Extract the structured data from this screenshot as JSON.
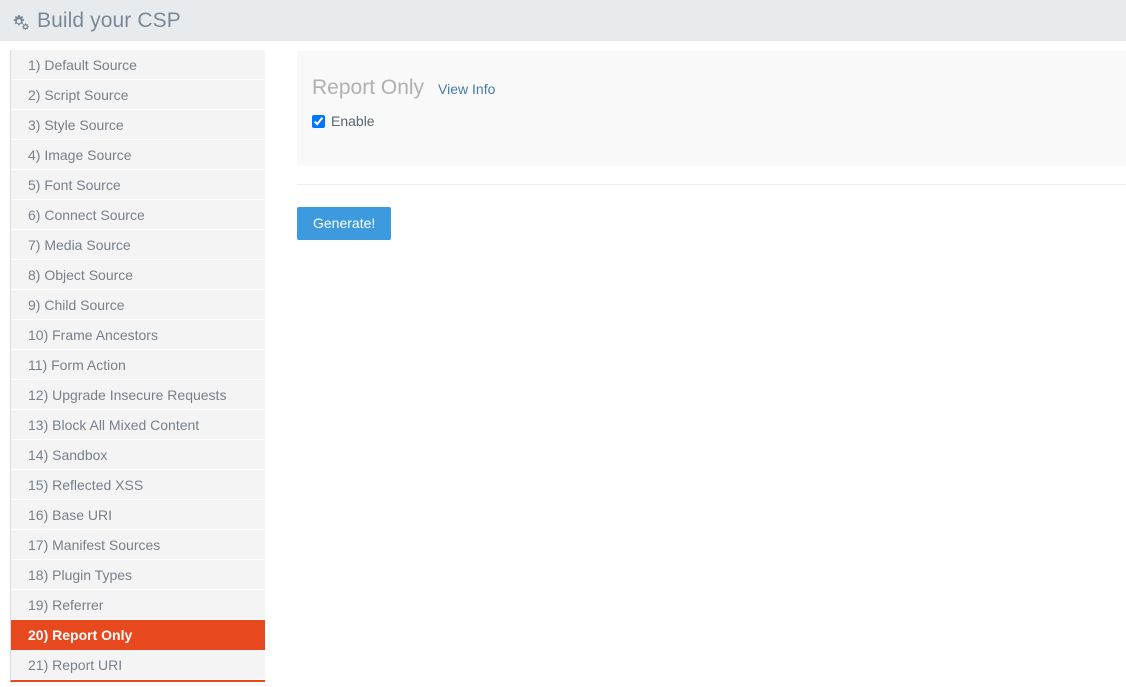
{
  "header": {
    "icon": "cogs-icon",
    "title": "Build your CSP",
    "background_color": "#e8ebee",
    "title_color": "#7b8a97"
  },
  "sidebar": {
    "active_index": 19,
    "active_color": "#e8481d",
    "item_background": "#f4f4f4",
    "item_text_color": "#76818c",
    "items": [
      {
        "label": "1) Default Source"
      },
      {
        "label": "2) Script Source"
      },
      {
        "label": "3) Style Source"
      },
      {
        "label": "4) Image Source"
      },
      {
        "label": "5) Font Source"
      },
      {
        "label": "6) Connect Source"
      },
      {
        "label": "7) Media Source"
      },
      {
        "label": "8) Object Source"
      },
      {
        "label": "9) Child Source"
      },
      {
        "label": "10) Frame Ancestors"
      },
      {
        "label": "11) Form Action"
      },
      {
        "label": "12) Upgrade Insecure Requests"
      },
      {
        "label": "13) Block All Mixed Content"
      },
      {
        "label": "14) Sandbox"
      },
      {
        "label": "15) Reflected XSS"
      },
      {
        "label": "16) Base URI"
      },
      {
        "label": "17) Manifest Sources"
      },
      {
        "label": "18) Plugin Types"
      },
      {
        "label": "19) Referrer"
      },
      {
        "label": "20) Report Only"
      },
      {
        "label": "21) Report URI"
      }
    ]
  },
  "main": {
    "panel": {
      "title": "Report Only",
      "view_info_label": "View Info",
      "view_info_color": "#4a7ba8",
      "checkbox": {
        "label": "Enable",
        "checked": true
      }
    },
    "generate_button": {
      "label": "Generate!",
      "color": "#3d9ade"
    }
  }
}
